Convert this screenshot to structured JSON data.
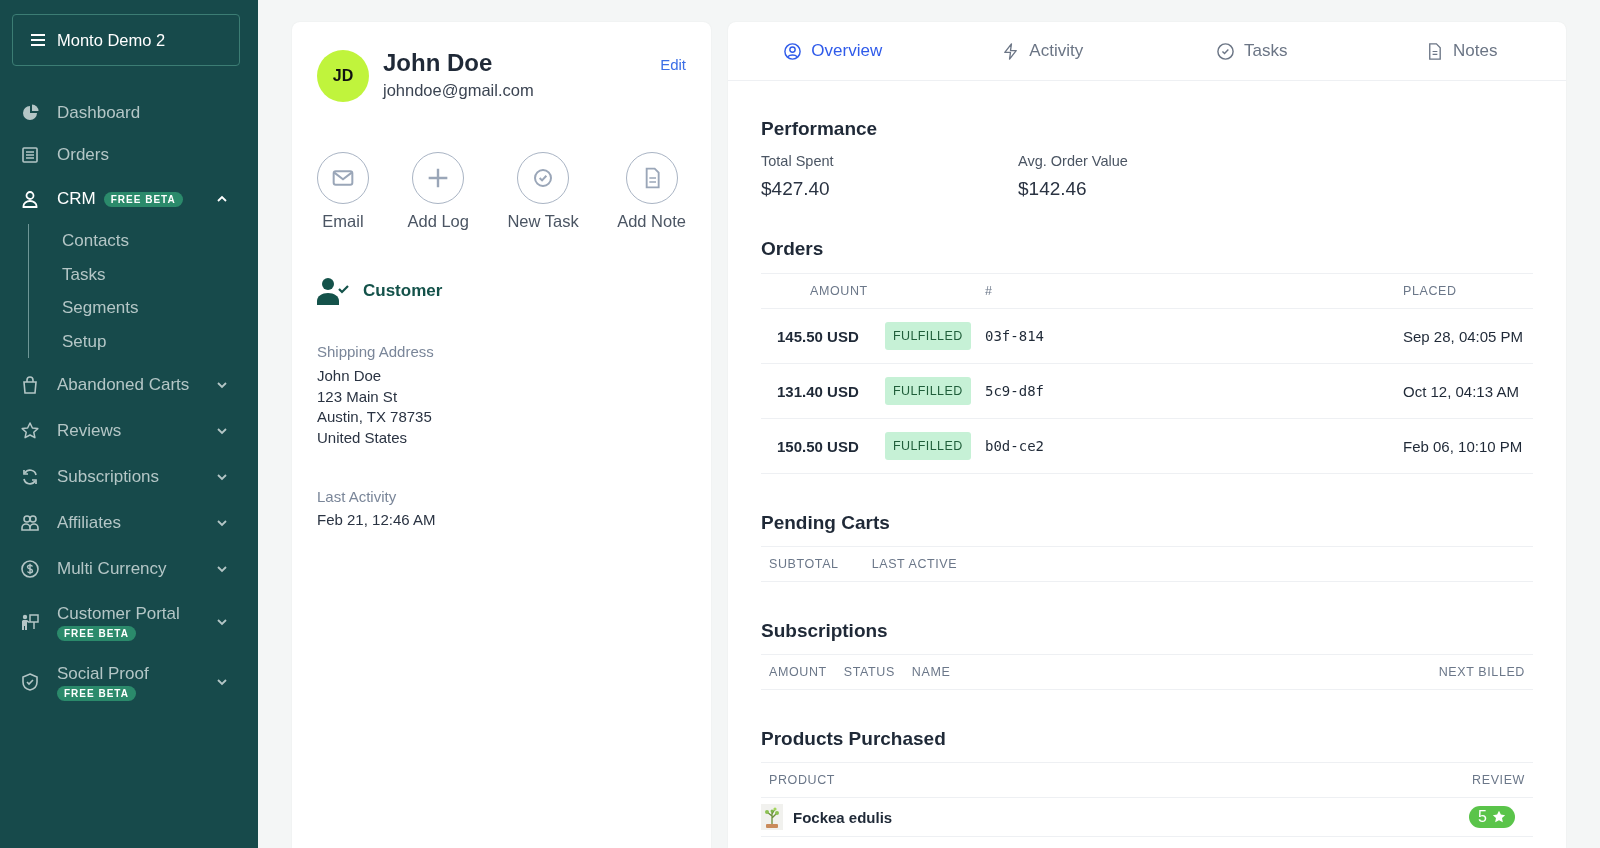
{
  "sidebar": {
    "store_button": {
      "label": "Monto Demo 2"
    },
    "items": [
      {
        "kind": "link",
        "label": "Dashboard",
        "selected": false
      },
      {
        "kind": "link",
        "label": "Orders",
        "selected": false
      },
      {
        "kind": "group",
        "label": "CRM",
        "badge": "FREE BETA",
        "selected": true,
        "expanded": true,
        "children": [
          {
            "label": "Contacts",
            "selected": false
          },
          {
            "label": "Tasks",
            "selected": false
          },
          {
            "label": "Segments",
            "selected": false
          },
          {
            "label": "Setup",
            "selected": false
          }
        ]
      },
      {
        "kind": "group",
        "label": "Abandoned Carts",
        "selected": false,
        "expanded": false
      },
      {
        "kind": "group",
        "label": "Reviews",
        "selected": false,
        "expanded": false
      },
      {
        "kind": "group",
        "label": "Subscriptions",
        "selected": false,
        "expanded": false
      },
      {
        "kind": "group",
        "label": "Affiliates",
        "selected": false,
        "expanded": false
      },
      {
        "kind": "group",
        "label": "Multi Currency",
        "selected": false,
        "expanded": false
      },
      {
        "kind": "group",
        "label": "Customer Portal",
        "badge": "FREE BETA",
        "selected": false,
        "expanded": false
      },
      {
        "kind": "group",
        "label": "Social Proof",
        "badge": "FREE BETA",
        "selected": false,
        "expanded": false
      }
    ]
  },
  "profile": {
    "initials": "JD",
    "name": "John Doe",
    "email": "johndoe@gmail.com",
    "edit_link": "Edit",
    "actions": [
      {
        "label": "Email"
      },
      {
        "label": "Add Log"
      },
      {
        "label": "New Task"
      },
      {
        "label": "Add Note"
      }
    ],
    "customer_tag": "Customer",
    "shipping": {
      "label": "Shipping Address",
      "lines": [
        "John Doe",
        "123 Main St",
        "Austin, TX 78735",
        "United States"
      ]
    },
    "last_activity": {
      "label": "Last Activity",
      "value": "Feb 21, 12:46 AM"
    }
  },
  "detail": {
    "tabs": [
      {
        "label": "Overview",
        "selected": true
      },
      {
        "label": "Activity",
        "selected": false
      },
      {
        "label": "Tasks",
        "selected": false
      },
      {
        "label": "Notes",
        "selected": false
      }
    ],
    "performance": {
      "title": "Performance",
      "metrics": [
        {
          "label": "Total Spent",
          "value": "$427.40"
        },
        {
          "label": "Avg. Order Value",
          "value": "$142.46"
        }
      ]
    },
    "orders": {
      "title": "Orders",
      "columns": [
        "AMOUNT",
        "#",
        "PLACED"
      ],
      "rows": [
        {
          "amount": "145.50 USD",
          "status": "FULFILLED",
          "number": "03f-814",
          "placed": "Sep 28, 04:05 PM"
        },
        {
          "amount": "131.40 USD",
          "status": "FULFILLED",
          "number": "5c9-d8f",
          "placed": "Oct 12, 04:13 AM"
        },
        {
          "amount": "150.50 USD",
          "status": "FULFILLED",
          "number": "b0d-ce2",
          "placed": "Feb 06, 10:10 PM"
        }
      ]
    },
    "pending_carts": {
      "title": "Pending Carts",
      "columns": [
        "SUBTOTAL",
        "LAST ACTIVE"
      ]
    },
    "subscriptions": {
      "title": "Subscriptions",
      "columns": [
        "AMOUNT",
        "STATUS",
        "NAME",
        "NEXT BILLED"
      ]
    },
    "products": {
      "title": "Products Purchased",
      "columns": [
        "PRODUCT",
        "REVIEW"
      ],
      "rows": [
        {
          "name": "Fockea edulis",
          "review": "5"
        }
      ]
    }
  }
}
